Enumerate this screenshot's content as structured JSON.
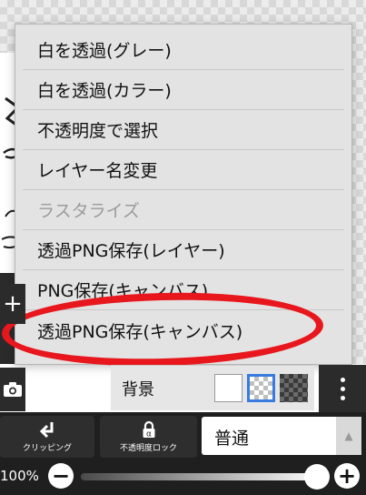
{
  "menu": {
    "items": [
      {
        "label": "白を透過(グレー)",
        "enabled": true
      },
      {
        "label": "白を透過(カラー)",
        "enabled": true
      },
      {
        "label": "不透明度で選択",
        "enabled": true
      },
      {
        "label": "レイヤー名変更",
        "enabled": true
      },
      {
        "label": "ラスタライズ",
        "enabled": false
      },
      {
        "label": "透過PNG保存(レイヤー)",
        "enabled": true
      },
      {
        "label": "PNG保存(キャンバス)",
        "enabled": true
      },
      {
        "label": "透過PNG保存(キャンバス)",
        "enabled": true,
        "highlighted": true
      }
    ]
  },
  "layer_panel": {
    "background_label": "背景",
    "background_options": [
      "white",
      "transparent",
      "dark-checker"
    ],
    "selected_background": "transparent"
  },
  "toolbar": {
    "clipping_label": "クリッピング",
    "opacity_lock_label": "不透明度ロック",
    "blend_mode": "普通",
    "opacity": "100%"
  },
  "colors": {
    "highlight_ring": "#e8171d",
    "selection_blue": "#3a7be0"
  }
}
